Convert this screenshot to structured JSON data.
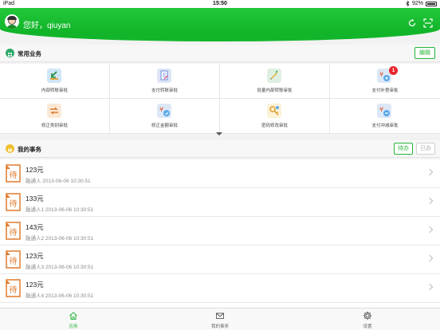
{
  "status_bar": {
    "device": "iPad",
    "time": "15:50",
    "battery": "92%"
  },
  "header": {
    "greeting": "您好，qiuyan"
  },
  "common_business": {
    "title": "常用业务",
    "edit_label": "编辑",
    "items": [
      {
        "label": "内部转账审批",
        "icon": "inner-transfer-icon"
      },
      {
        "label": "支付转账审批",
        "icon": "pay-transfer-icon"
      },
      {
        "label": "批量内部转账审批",
        "icon": "batch-transfer-icon"
      },
      {
        "label": "支付补登审批",
        "icon": "pay-supplement-icon",
        "badge": "1"
      },
      {
        "label": "修正类别审批",
        "icon": "correct-category-icon"
      },
      {
        "label": "修正金额审批",
        "icon": "correct-amount-icon"
      },
      {
        "label": "密码修改审批",
        "icon": "password-change-icon"
      },
      {
        "label": "支付冲减审批",
        "icon": "pay-offset-icon"
      }
    ]
  },
  "my_tasks": {
    "title": "我的事务",
    "tab_todo": "待办",
    "tab_done": "已办",
    "flag_char": "待",
    "items": [
      {
        "amount": "123元",
        "meta": "融通人 2013-06-06 10:30:51"
      },
      {
        "amount": "133元",
        "meta": "融通人1 2013-06-06 10:30:51"
      },
      {
        "amount": "143元",
        "meta": "融通人2 2013-06-06 10:30:51"
      },
      {
        "amount": "123元",
        "meta": "融通人3 2013-06-06 10:30:51"
      },
      {
        "amount": "123元",
        "meta": "融通人4 2013-06-06 10:30:51"
      }
    ]
  },
  "tab_bar": {
    "items": [
      {
        "label": "应用",
        "active": true
      },
      {
        "label": "我的事务"
      },
      {
        "label": "设置"
      }
    ]
  },
  "colors": {
    "brand_green": "#27b43c",
    "badge_red": "#e8262d",
    "flag_orange": "#e07a2c"
  }
}
